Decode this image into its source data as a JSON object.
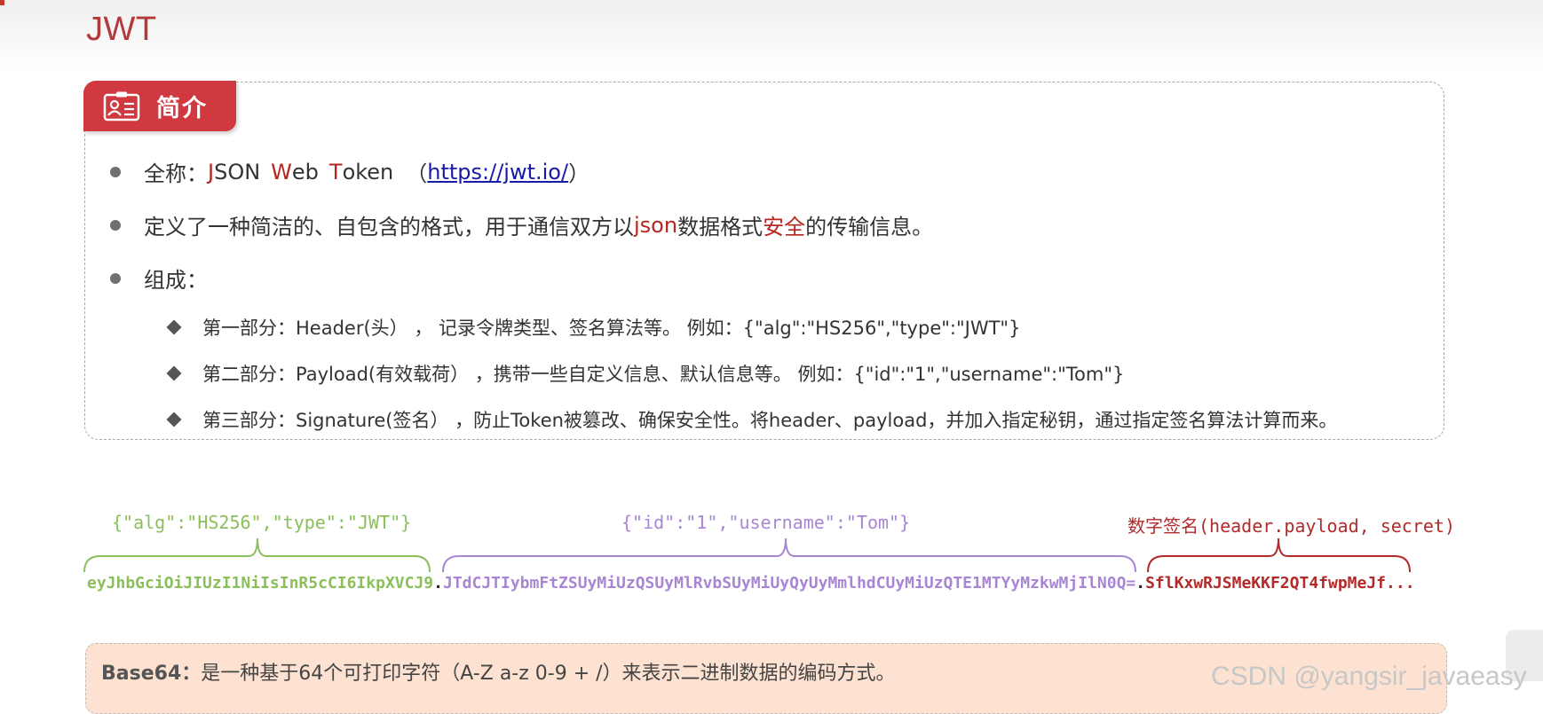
{
  "page": {
    "title": "JWT"
  },
  "intro": {
    "tab_label": "简介",
    "b1": {
      "prefix": "全称：",
      "j": "J",
      "son": "SON",
      "w": "W",
      "eb": "eb",
      "t": "T",
      "oken": "oken",
      "open": "（",
      "link": "https://jwt.io/",
      "close": "）"
    },
    "b2": {
      "text_a": "定义了一种简洁的、自包含的格式，用于通信双方以",
      "json": "json",
      "text_b": "数据格式",
      "safe": "安全",
      "text_c": "的传输信息。"
    },
    "b3": {
      "text": "组成："
    },
    "parts": [
      {
        "text": "第一部分：Header(头） ，  记录令牌类型、签名算法等。 例如：{\"alg\":\"HS256\",\"type\":\"JWT\"}"
      },
      {
        "text": "第二部分：Payload(有效载荷） ，携带一些自定义信息、默认信息等。 例如：{\"id\":\"1\",\"username\":\"Tom\"}"
      },
      {
        "text": "第三部分：Signature(签名） ，防止Token被篡改、确保安全性。将header、payload，并加入指定秘钥，通过指定签名算法计算而来。"
      }
    ]
  },
  "jwt": {
    "header_label": "{\"alg\":\"HS256\",\"type\":\"JWT\"}",
    "payload_label": "{\"id\":\"1\",\"username\":\"Tom\"}",
    "signature_label_cn": "数字签名",
    "signature_label_code": "(header.payload, secret)",
    "header_token": "eyJhbGciOiJIUzI1NiIsInR5cCI6IkpXVCJ9",
    "dot1": ".",
    "payload_token": "JTdCJTIybmFtZSUyMiUzQSUyMlRvbSUyMiUyQyUyMmlhdCUyMiUzQTE1MTYyMzkwMjIlN0Q=",
    "dot2": ".",
    "signature_token": "SflKxwRJSMeKKF2QT4fwpMeJf..."
  },
  "base64": {
    "term": "Base64：",
    "text": "是一种基于64个可打印字符（A-Z a-z 0-9 + /）来表示二进制数据的编码方式。"
  },
  "watermark": "CSDN @yangsir_javaeasy",
  "colors": {
    "accent_red": "#d0393f",
    "header_green": "#8bbf5c",
    "payload_purple": "#a886d4",
    "signature_red": "#b22a2a",
    "base64_bg": "#fde2d2"
  }
}
